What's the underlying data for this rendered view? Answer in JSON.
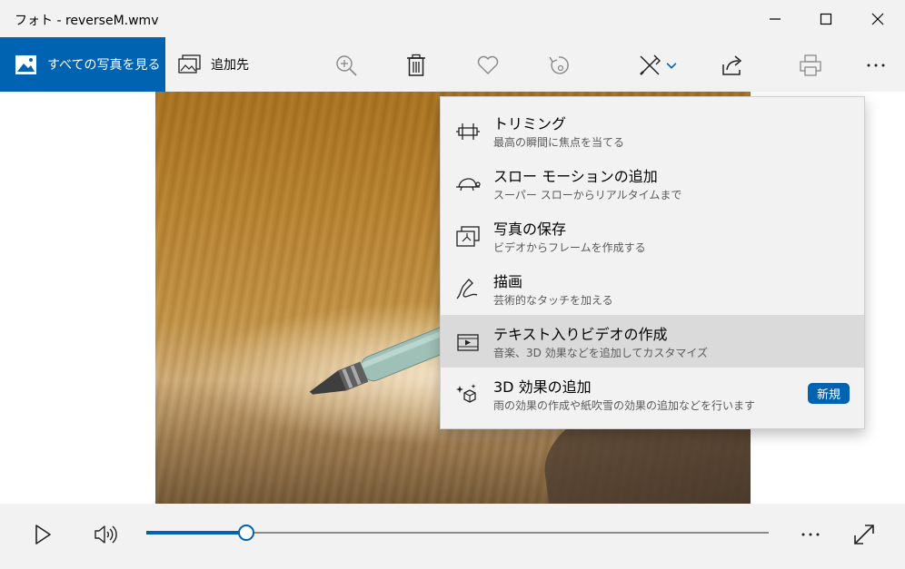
{
  "window": {
    "title": "フォト - reverseM.wmv",
    "controls": [
      "minimize-icon",
      "maximize-icon",
      "close-icon"
    ]
  },
  "toolbar": {
    "all_photos_label": "すべての写真を見る",
    "add_to_label": "追加先",
    "buttons": [
      "zoom-in-icon",
      "delete-icon",
      "favorite-heart-icon",
      "rotate-icon",
      "edit-create-icon",
      "share-icon",
      "print-icon",
      "more-icon"
    ]
  },
  "accent_color": "#0063b1",
  "menu": {
    "items": [
      {
        "title": "トリミング",
        "subtitle": "最高の瞬間に焦点を当てる",
        "icon": "trim-icon"
      },
      {
        "title": "スロー モーションの追加",
        "subtitle": "スーパー スローからリアルタイムまで",
        "icon": "slow-motion-turtle-icon"
      },
      {
        "title": "写真の保存",
        "subtitle": "ビデオからフレームを作成する",
        "icon": "save-photo-icon"
      },
      {
        "title": "描画",
        "subtitle": "芸術的なタッチを加える",
        "icon": "draw-pen-icon"
      },
      {
        "title": "テキスト入りビデオの作成",
        "subtitle": "音楽、3D 効果などを追加してカスタマイズ",
        "icon": "video-with-text-icon",
        "highlighted": true
      },
      {
        "title": "3D 効果の追加",
        "subtitle": "雨の効果の作成や紙吹雪の効果の追加などを行います",
        "icon": "3d-effects-icon",
        "badge": "新規"
      }
    ]
  },
  "playback": {
    "progress": 0.16,
    "controls": [
      "play-icon",
      "volume-icon",
      "more-icon",
      "fullscreen-icon"
    ]
  }
}
